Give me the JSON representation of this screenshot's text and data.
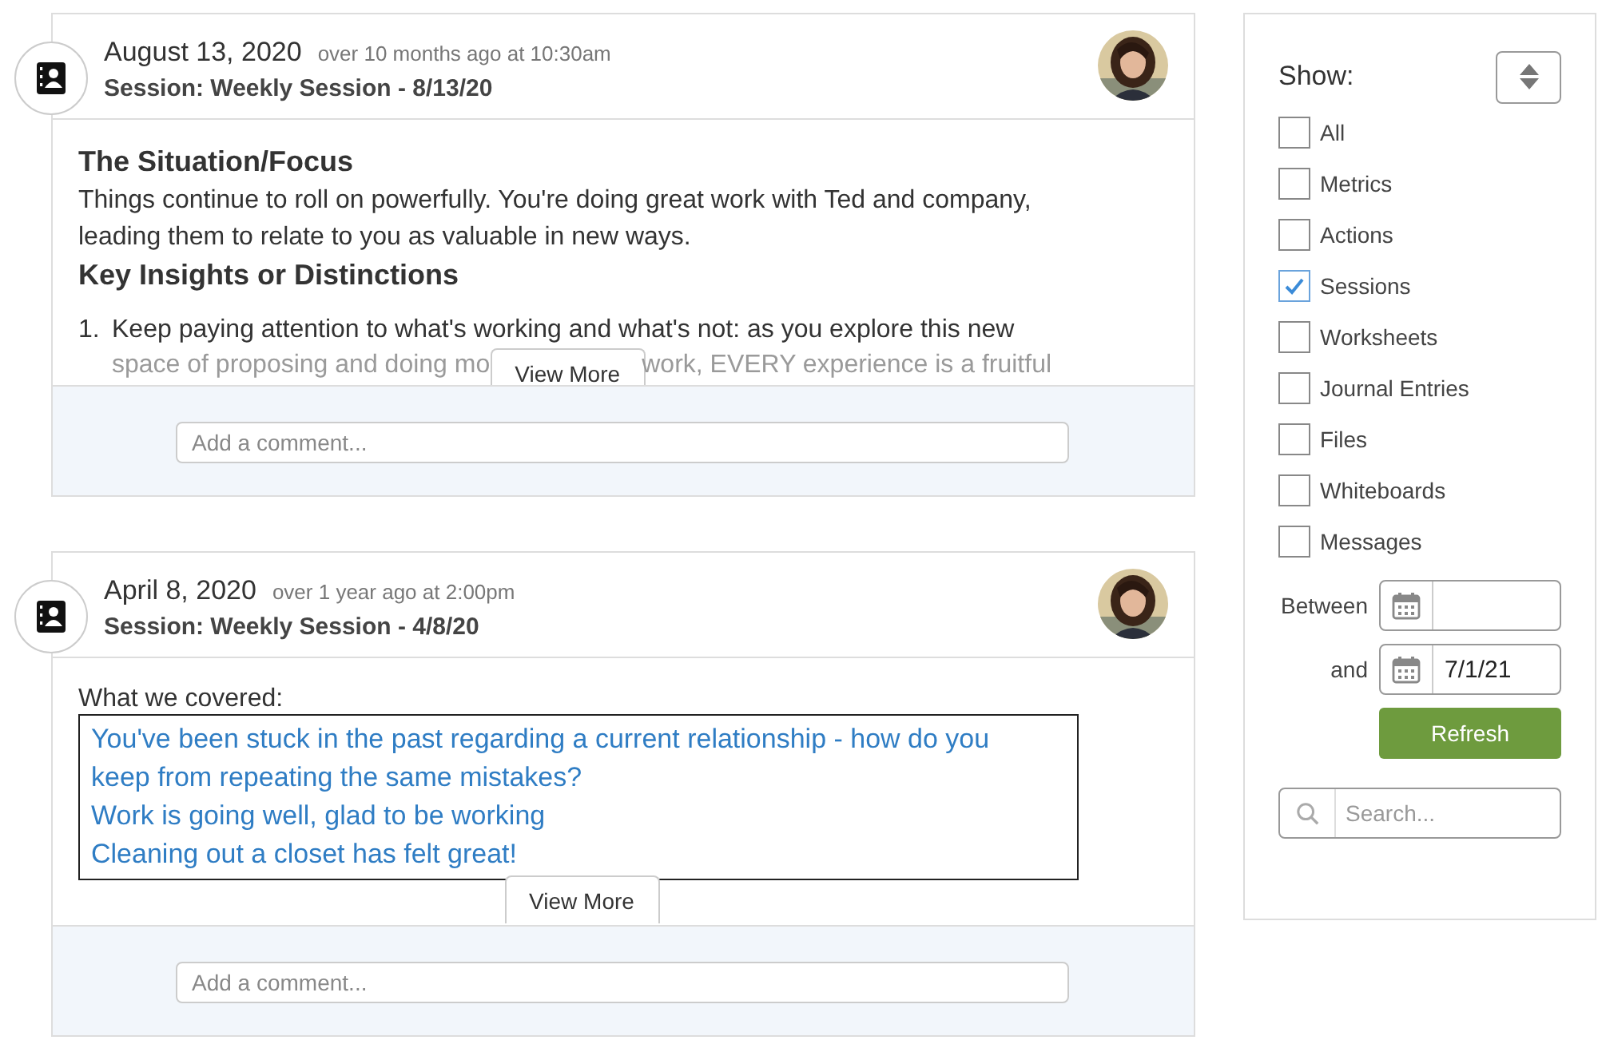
{
  "entries": [
    {
      "date": "August 13, 2020",
      "ago": "over 10 months ago at 10:30am",
      "title": "Session: Weekly Session - 8/13/20",
      "body": {
        "kind": "notes",
        "blocks": [
          {
            "kind": "heading",
            "text": "The Situation/Focus"
          },
          {
            "kind": "paragraph",
            "text": "Things continue to roll on powerfully. You're doing great work with Ted and company, leading them to relate to you as valuable in new ways."
          },
          {
            "kind": "heading",
            "text": "Key Insights or Distinctions"
          },
          {
            "kind": "list_item",
            "number": "1.",
            "text": "Keep paying attention to what's working and what's not: as you explore this new",
            "faded_before": "space of proposing and doing mo",
            "faded_after": "work, EVERY experience is a fruitful"
          }
        ]
      },
      "view_more": "View More",
      "comment_placeholder": "Add a comment..."
    },
    {
      "date": "April 8, 2020",
      "ago": "over 1 year ago at 2:00pm",
      "title": "Session: Weekly Session - 4/8/20",
      "body": {
        "kind": "covered",
        "label": "What we covered:",
        "items": [
          "You've been stuck in the past regarding a current relationship - how do you keep from repeating the same mistakes?",
          "Work is going well, glad to be working",
          "Cleaning out a closet has felt great!"
        ]
      },
      "view_more": "View More",
      "comment_placeholder": "Add a comment..."
    }
  ],
  "sidebar": {
    "show_label": "Show:",
    "filters": [
      {
        "label": "All",
        "checked": false
      },
      {
        "label": "Metrics",
        "checked": false
      },
      {
        "label": "Actions",
        "checked": false
      },
      {
        "label": "Sessions",
        "checked": true
      },
      {
        "label": "Worksheets",
        "checked": false
      },
      {
        "label": "Journal Entries",
        "checked": false
      },
      {
        "label": "Files",
        "checked": false
      },
      {
        "label": "Whiteboards",
        "checked": false
      },
      {
        "label": "Messages",
        "checked": false
      }
    ],
    "between_label": "Between",
    "and_label": "and",
    "to_date": {
      "value": "7/1/21"
    },
    "refresh": "Refresh",
    "search": {
      "placeholder": "Search..."
    }
  }
}
